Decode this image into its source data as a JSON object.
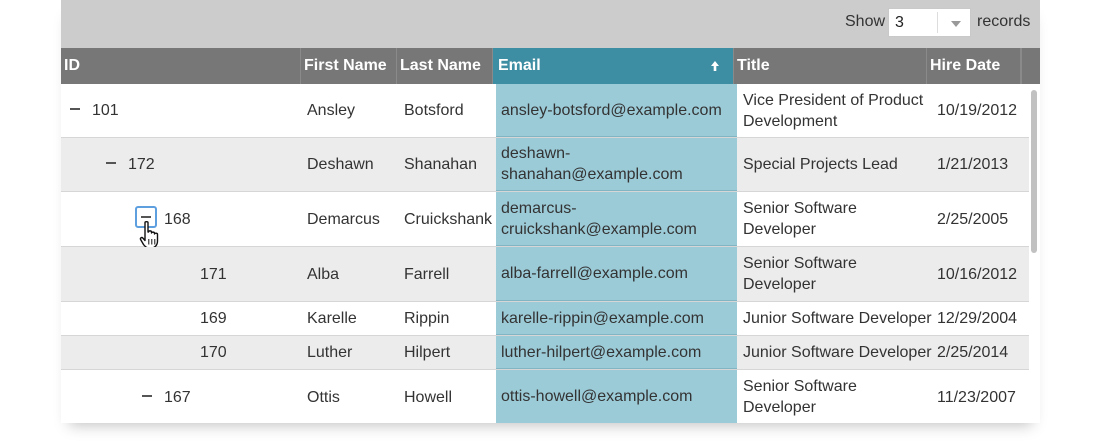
{
  "toolbar": {
    "show_label": "Show",
    "page_size": "3",
    "records_label": "records"
  },
  "columns": [
    {
      "key": "id",
      "label": "ID"
    },
    {
      "key": "first",
      "label": "First Name"
    },
    {
      "key": "last",
      "label": "Last Name"
    },
    {
      "key": "email",
      "label": "Email",
      "sort": "ascending"
    },
    {
      "key": "title",
      "label": "Title"
    },
    {
      "key": "hire",
      "label": "Hire Date"
    }
  ],
  "rows": [
    {
      "id": "101",
      "first": "Ansley",
      "last": "Botsford",
      "email": "ansley-botsford@example.com",
      "title": "Vice President of Product Development",
      "hire": "10/19/2012",
      "expander": "expanded"
    },
    {
      "id": "172",
      "first": "Deshawn",
      "last": "Shanahan",
      "email": "deshawn-shanahan@example.com",
      "title": "Special Projects Lead",
      "hire": "1/21/2013",
      "expander": "expanded"
    },
    {
      "id": "168",
      "first": "Demarcus",
      "last": "Cruickshank",
      "email": "demarcus-cruickshank@example.com",
      "title": "Senior Software Developer",
      "hire": "2/25/2005",
      "expander": "expanded-focused"
    },
    {
      "id": "171",
      "first": "Alba",
      "last": "Farrell",
      "email": "alba-farrell@example.com",
      "title": "Senior Software Developer",
      "hire": "10/16/2012",
      "expander": "none"
    },
    {
      "id": "169",
      "first": "Karelle",
      "last": "Rippin",
      "email": "karelle-rippin@example.com",
      "title": "Junior Software Developer",
      "hire": "12/29/2004",
      "expander": "none"
    },
    {
      "id": "170",
      "first": "Luther",
      "last": "Hilpert",
      "email": "luther-hilpert@example.com",
      "title": "Junior Software Developer",
      "hire": "2/25/2014",
      "expander": "none"
    },
    {
      "id": "167",
      "first": "Ottis",
      "last": "Howell",
      "email": "ottis-howell@example.com",
      "title": "Senior Software Developer",
      "hire": "11/23/2007",
      "expander": "expanded"
    }
  ],
  "colors": {
    "header_bg": "#777777",
    "sorted_header_bg": "#3e8ea3",
    "sorted_column_bg": "#9ccbd8",
    "toolbar_bg": "#cccccc",
    "alt_row_bg": "#ececec",
    "focus_ring": "#5ea0df"
  },
  "icons": {
    "sort": "arrow-up-icon",
    "expander": "minus-icon",
    "pointer": "hand-cursor-icon",
    "dropdown": "chevron-down-icon"
  }
}
